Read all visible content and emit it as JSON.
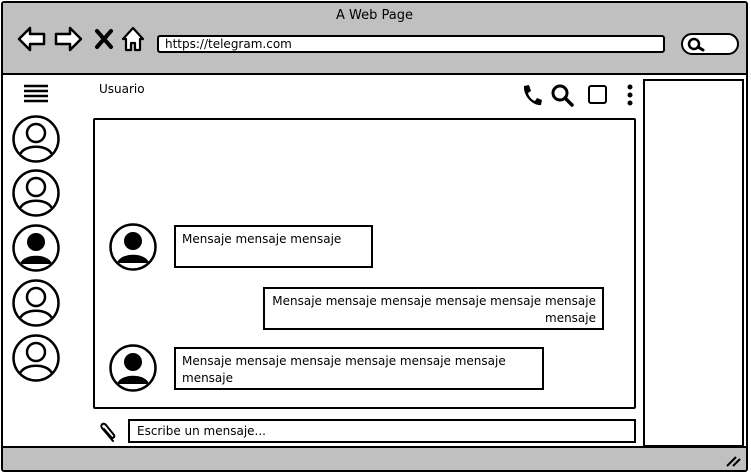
{
  "window": {
    "title": "A Web Page"
  },
  "browser": {
    "url": "https://telegram.com"
  },
  "chat": {
    "user_name": "Usuario"
  },
  "messages": [
    {
      "text": "Mensaje mensaje mensaje",
      "side": "left"
    },
    {
      "text": "Mensaje mensaje mensaje mensaje mensaje mensaje mensaje",
      "side": "right"
    },
    {
      "text": "Mensaje mensaje mensaje mensaje mensaje mensaje mensaje",
      "side": "left"
    }
  ],
  "composer": {
    "placeholder": "Escribe un mensaje..."
  },
  "contacts": [
    {
      "icon": "avatar-icon",
      "style": "outline"
    },
    {
      "icon": "avatar-icon",
      "style": "outline"
    },
    {
      "icon": "avatar-icon",
      "style": "filled"
    },
    {
      "icon": "avatar-icon",
      "style": "outline"
    },
    {
      "icon": "avatar-icon",
      "style": "outline"
    }
  ],
  "colors": {
    "chrome": "#c0c0c0",
    "stroke": "#000000",
    "background": "#ffffff"
  }
}
